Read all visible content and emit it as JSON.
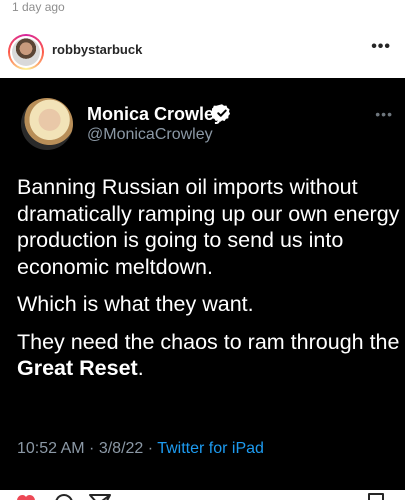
{
  "post": {
    "time_ago": "1 day ago",
    "username": "robbystarbuck",
    "more_label": "•••"
  },
  "tweet": {
    "name": "Monica Crowley",
    "handle": "@MonicaCrowley",
    "more_label": "•••",
    "paragraphs": [
      {
        "text": "Banning Russian oil imports without dramatically ramping up our own energy production is going to send us into economic meltdown."
      },
      {
        "text": "Which is what they want."
      },
      {
        "prefix": "They need the chaos to ram through the ",
        "bold": "Great Reset",
        "suffix": "."
      }
    ],
    "timestamp": "10:52 AM · 3/8/22 · ",
    "source": "Twitter for iPad"
  },
  "colors": {
    "tweet_background": "#000000",
    "link_blue": "#1d9bf0",
    "verified_badge": "#ffffff",
    "like_red": "#ed4956"
  },
  "icons": {
    "like": "heart-icon",
    "comment": "comment-icon",
    "share": "paper-plane-icon",
    "save": "bookmark-icon",
    "verified": "verified-badge-icon"
  }
}
